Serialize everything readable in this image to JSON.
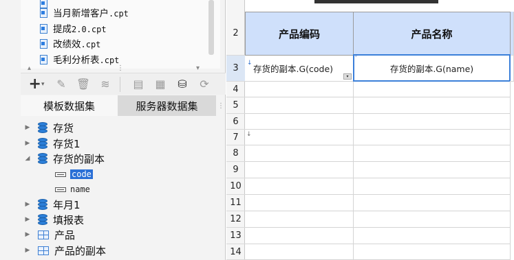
{
  "files": [
    {
      "name": "当月新增客户",
      "ext": ".cpt"
    },
    {
      "name": "提成",
      "ext": "2.0.cpt"
    },
    {
      "name": "改绩效",
      "ext": ".cpt"
    },
    {
      "name": "毛利分析表",
      "ext": ".cpt"
    }
  ],
  "toolbar": {
    "add_label": "+"
  },
  "tabs": {
    "template_dataset": "模板数据集",
    "server_dataset": "服务器数据集"
  },
  "tree": {
    "n1": "存货",
    "n2": "存货1",
    "n3": "存货的副本",
    "f1": "code",
    "f2": "name",
    "n4": "年月1",
    "n5": "填报表",
    "n6": "产品",
    "n7": "产品的副本"
  },
  "sheet": {
    "rows": [
      "2",
      "3",
      "4",
      "5",
      "6",
      "7",
      "8",
      "9",
      "10",
      "11",
      "12",
      "13",
      "14"
    ],
    "header_col1": "产品编码",
    "header_col2": "产品名称",
    "cell_b3": "存货的副本.G(code)",
    "cell_c3": "存货的副本.G(name)"
  }
}
